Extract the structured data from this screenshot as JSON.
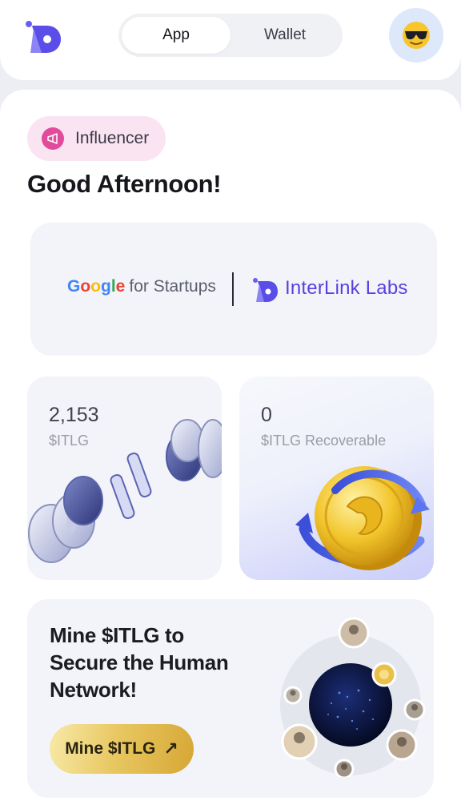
{
  "header": {
    "tabs": [
      {
        "label": "App",
        "active": true
      },
      {
        "label": "Wallet",
        "active": false
      }
    ],
    "avatar_icon": "sunglasses-face-emoji",
    "logo_icon": "interlink-logo-icon"
  },
  "badge": {
    "label": "Influencer",
    "icon": "megaphone-icon",
    "color": "#e24b9b"
  },
  "greeting": "Good Afternoon!",
  "partner": {
    "google_word": "Google",
    "google_suffix": "for Startups",
    "interlink_name": "InterLink Labs"
  },
  "balance": {
    "value": "2,153",
    "unit": "$ITLG"
  },
  "recoverable": {
    "value": "0",
    "unit": "$ITLG Recoverable"
  },
  "mine_card": {
    "lines": [
      "Mine $ITLG to",
      "Secure the Human",
      "Network!"
    ],
    "button_label": "Mine $ITLG"
  },
  "colors": {
    "brand_purple": "#5b3fe0",
    "gold": "#e8c862"
  }
}
